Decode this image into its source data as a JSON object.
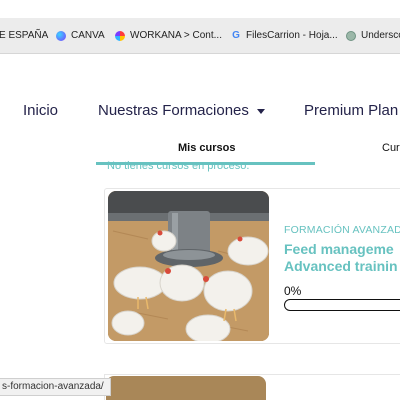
{
  "bookmarks": [
    {
      "label": "E ESPAÑA",
      "icon": "none"
    },
    {
      "label": "CANVA",
      "icon": "canva-icon"
    },
    {
      "label": "WORKANA > Cont...",
      "icon": "workana-icon"
    },
    {
      "label": "FilesCarrion - Hoja...",
      "icon": "google-icon"
    },
    {
      "label": "Undersco",
      "icon": "underscore-icon"
    }
  ],
  "nav": {
    "home": "Inicio",
    "trainings": "Nuestras Formaciones",
    "premium": "Premium Plan"
  },
  "tabs": {
    "active": "Mis cursos",
    "other": "Cur"
  },
  "empty_message": "No tienes cursos en proceso.",
  "course": {
    "category": "FORMACIÓN AVANZADA",
    "title_line1": "Feed manageme",
    "title_line2": "Advanced trainin",
    "progress_text": "0%",
    "progress": 0
  },
  "status_url": "s-formacion-avanzada/",
  "colors": {
    "accent": "#67c2c0",
    "nav_text": "#24234a"
  }
}
